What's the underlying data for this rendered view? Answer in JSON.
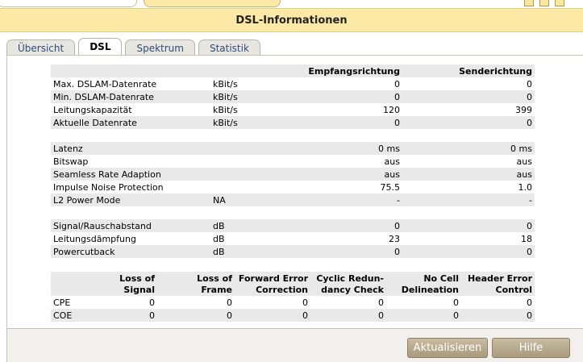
{
  "header": {
    "title": "DSL-Informationen"
  },
  "tabs": [
    "Übersicht",
    "DSL",
    "Spektrum",
    "Statistik"
  ],
  "active_tab": "DSL",
  "dsl_table": {
    "col_headers": [
      "",
      "",
      "Empfangsrichtung",
      "Senderichtung"
    ],
    "rows": [
      [
        "Max. DSLAM-Datenrate",
        "kBit/s",
        "0",
        "0"
      ],
      [
        "Min. DSLAM-Datenrate",
        "kBit/s",
        "0",
        "0"
      ],
      [
        "Leitungskapazität",
        "kBit/s",
        "120",
        "399"
      ],
      [
        "Aktuelle Datenrate",
        "kBit/s",
        "0",
        "0"
      ],
      [
        "",
        "",
        "",
        ""
      ],
      [
        "Latenz",
        "",
        "0 ms",
        "0 ms"
      ],
      [
        "Bitswap",
        "",
        "aus",
        "aus"
      ],
      [
        "Seamless Rate Adaption",
        "",
        "aus",
        "aus"
      ],
      [
        "Impulse Noise Protection",
        "",
        "75.5",
        "1.0"
      ],
      [
        "L2 Power Mode",
        "NA",
        "-",
        "-"
      ],
      [
        "",
        "",
        "",
        ""
      ],
      [
        "Signal/Rauschabstand",
        "dB",
        "0",
        "0"
      ],
      [
        "Leitungsdämpfung",
        "dB",
        "23",
        "18"
      ],
      [
        "Powercutback",
        "dB",
        "0",
        "0"
      ]
    ]
  },
  "error_table": {
    "col_headers": [
      [
        "",
        ""
      ],
      [
        "Loss of",
        "Signal"
      ],
      [
        "Loss of",
        "Frame"
      ],
      [
        "Forward Error",
        "Correction"
      ],
      [
        "Cyclic Redun-",
        "dancy Check"
      ],
      [
        "No Cell",
        "Delineation"
      ],
      [
        "Header Error",
        "Control"
      ]
    ],
    "rows": [
      [
        "CPE",
        "0",
        "0",
        "0",
        "0",
        "0",
        "0"
      ],
      [
        "COE",
        "0",
        "0",
        "0",
        "0",
        "0",
        "0"
      ]
    ]
  },
  "buttons": {
    "refresh": "Aktualisieren",
    "help": "Hilfe"
  }
}
